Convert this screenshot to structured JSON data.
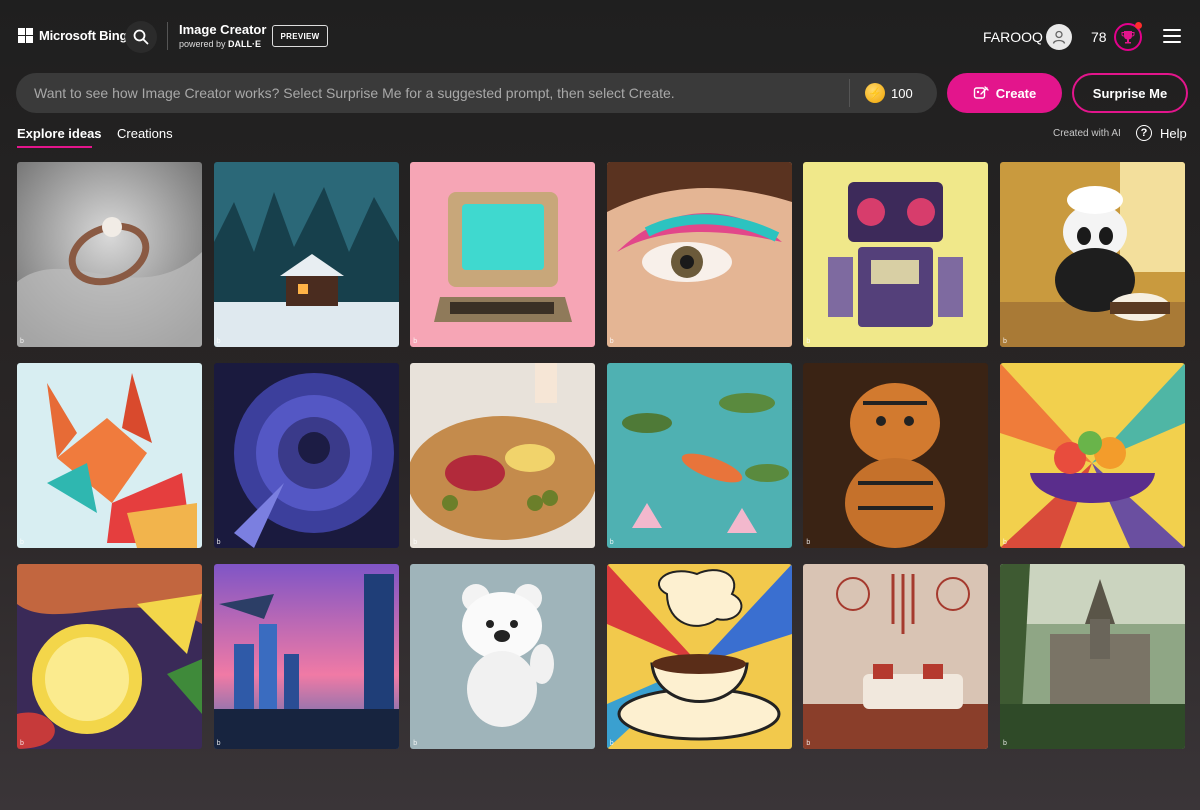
{
  "header": {
    "brand_label": "Microsoft Bing",
    "app_title": "Image Creator",
    "powered_by_prefix": "powered by",
    "powered_by_name": "DALL·E",
    "preview_badge": "PREVIEW",
    "username": "FAROOQ",
    "reward_points": "78",
    "icons": [
      "windows-logo-icon",
      "search-icon",
      "user-avatar-icon",
      "rewards-trophy-icon",
      "hamburger-menu-icon"
    ]
  },
  "prompt": {
    "placeholder": "Want to see how Image Creator works? Select Surprise Me for a suggested prompt, then select Create.",
    "value": "",
    "boost_count": "100",
    "create_label": "Create",
    "surprise_label": "Surprise Me"
  },
  "tabs": [
    {
      "label": "Explore ideas",
      "active": true
    },
    {
      "label": "Creations",
      "active": false
    }
  ],
  "toolbar": {
    "created_with_ai": "Created with AI",
    "help_label": "Help"
  },
  "colors": {
    "accent": "#e3158c",
    "background": "#1f1f1f",
    "prompt_bar": "#3a3a3a"
  },
  "gallery": [
    {
      "subject": "pearl-ring"
    },
    {
      "subject": "snowy-cabin"
    },
    {
      "subject": "retro-computer"
    },
    {
      "subject": "eye-makeup"
    },
    {
      "subject": "retro-robot"
    },
    {
      "subject": "panda-baker"
    },
    {
      "subject": "paper-fox"
    },
    {
      "subject": "blue-dahlia"
    },
    {
      "subject": "charcuterie-board"
    },
    {
      "subject": "koi-pond"
    },
    {
      "subject": "tiger-figurines"
    },
    {
      "subject": "fruit-bowl"
    },
    {
      "subject": "lemon-painting"
    },
    {
      "subject": "futuristic-city"
    },
    {
      "subject": "white-bear-toy"
    },
    {
      "subject": "pop-art-coffee"
    },
    {
      "subject": "boho-room"
    },
    {
      "subject": "forest-mansion"
    }
  ],
  "card_mark": "b"
}
